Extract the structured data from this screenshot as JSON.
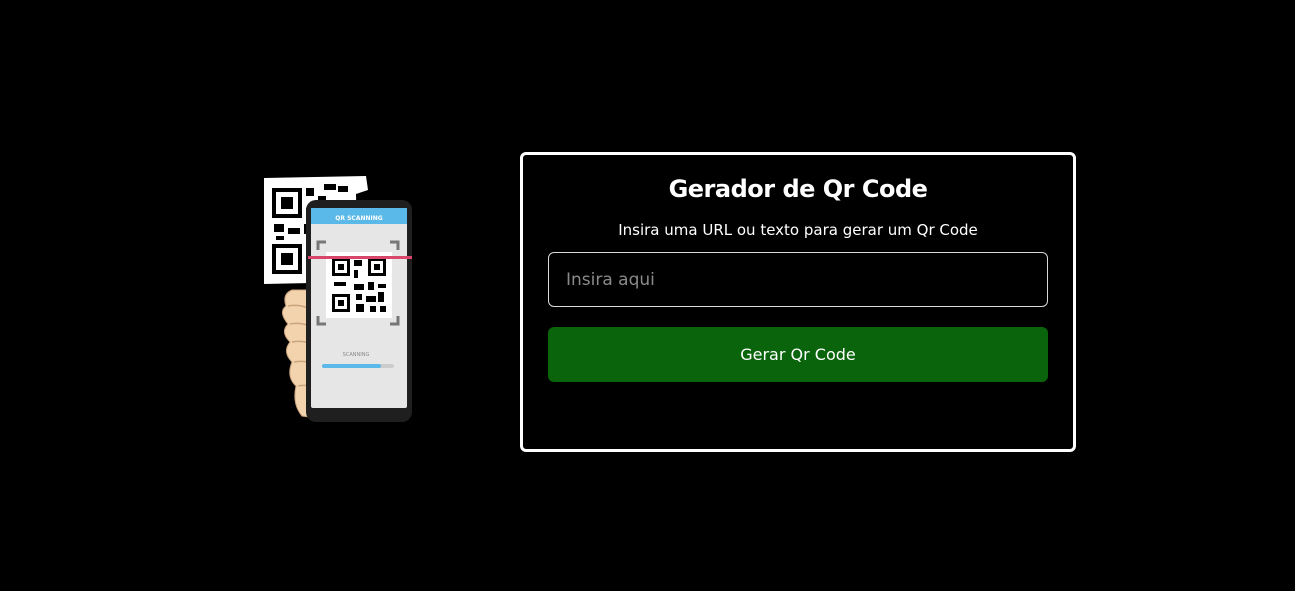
{
  "illustration": {
    "phone_header": "QR SCANNING",
    "phone_status": "SCANNING",
    "scan_progress": 0.82,
    "colors": {
      "phone_header": "#5ab9e8",
      "scan_line": "#d6476b",
      "progress": "#5ab9e8",
      "hand": "#f2d3ad"
    }
  },
  "form": {
    "title": "Gerador de Qr Code",
    "subtitle": "Insira uma URL ou texto para gerar um Qr Code",
    "input_value": "",
    "input_placeholder": "Insira aqui",
    "button_label": "Gerar Qr Code"
  },
  "colors": {
    "background": "#000000",
    "card_border": "#ffffff",
    "button": "#0a640c",
    "text": "#ffffff"
  }
}
